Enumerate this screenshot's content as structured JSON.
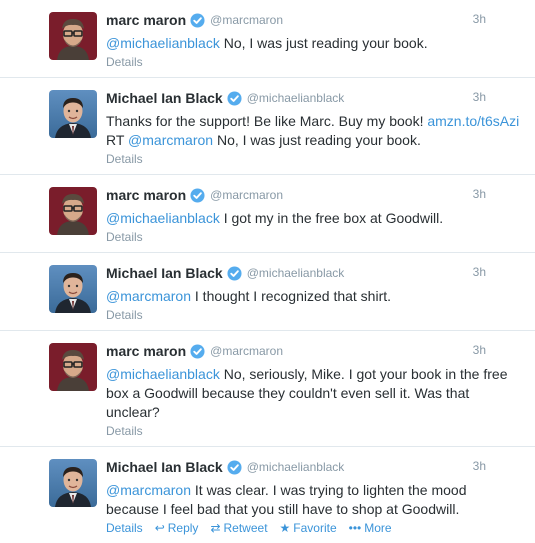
{
  "tweets": [
    {
      "name": "marc maron",
      "handle": "@marcmaron",
      "time": "3h",
      "segments": [
        {
          "type": "mention",
          "text": "@michaelianblack"
        },
        {
          "type": "text",
          "text": " No, I was just reading your book."
        }
      ],
      "details": "Details",
      "avatar": "marc"
    },
    {
      "name": "Michael Ian Black",
      "handle": "@michaelianblack",
      "time": "3h",
      "segments": [
        {
          "type": "text",
          "text": "Thanks for the support! Be like Marc. Buy my book! "
        },
        {
          "type": "link",
          "text": "amzn.to/t6sAzi"
        },
        {
          "type": "text",
          "text": " RT "
        },
        {
          "type": "mention",
          "text": "@marcmaron"
        },
        {
          "type": "text",
          "text": " No, I was just reading your book."
        }
      ],
      "details": "Details",
      "avatar": "michael"
    },
    {
      "name": "marc maron",
      "handle": "@marcmaron",
      "time": "3h",
      "segments": [
        {
          "type": "mention",
          "text": "@michaelianblack"
        },
        {
          "type": "text",
          "text": " I got my in the free box at Goodwill."
        }
      ],
      "details": "Details",
      "avatar": "marc"
    },
    {
      "name": "Michael Ian Black",
      "handle": "@michaelianblack",
      "time": "3h",
      "segments": [
        {
          "type": "mention",
          "text": "@marcmaron"
        },
        {
          "type": "text",
          "text": " I thought I recognized that shirt."
        }
      ],
      "details": "Details",
      "avatar": "michael"
    },
    {
      "name": "marc maron",
      "handle": "@marcmaron",
      "time": "3h",
      "segments": [
        {
          "type": "mention",
          "text": "@michaelianblack"
        },
        {
          "type": "text",
          "text": " No, seriously, Mike. I got your book in the free box a Goodwill because they couldn't even sell it. Was that unclear?"
        }
      ],
      "details": "Details",
      "avatar": "marc"
    },
    {
      "name": "Michael Ian Black",
      "handle": "@michaelianblack",
      "time": "3h",
      "segments": [
        {
          "type": "mention",
          "text": "@marcmaron"
        },
        {
          "type": "text",
          "text": " It was clear. I was trying to lighten the mood because I feel bad that you still have to shop at Goodwill."
        }
      ],
      "details": "Details",
      "avatar": "michael",
      "actions": {
        "reply": "Reply",
        "retweet": "Retweet",
        "favorite": "Favorite",
        "more": "More"
      }
    }
  ],
  "colors": {
    "link": "#3b94d9",
    "muted": "#8899a6",
    "verified": "#55acee",
    "marc_bg": "#7a1d2b",
    "michael_bg": "#3b6b99"
  },
  "icons": {
    "verified": "verified-badge-icon",
    "reply": "reply-icon",
    "retweet": "retweet-icon",
    "favorite": "star-icon",
    "more": "more-dots-icon"
  }
}
